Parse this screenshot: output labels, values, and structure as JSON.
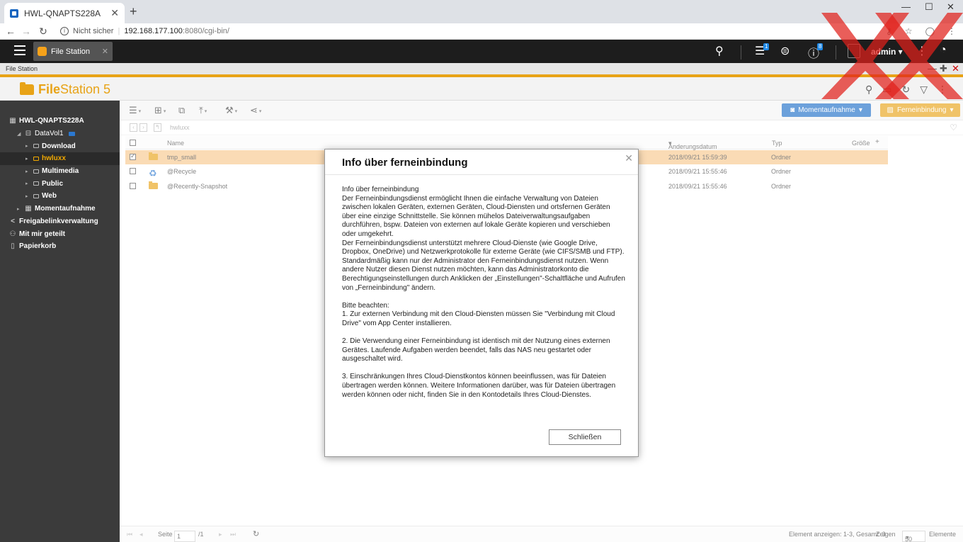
{
  "browser": {
    "tab_title": "HWL-QNAPTS228A",
    "new_tab": "+",
    "security": "Nicht sicher",
    "url_host": "192.168.177.100",
    "url_path": ":8080/cgi-bin/"
  },
  "qts": {
    "app_tab": "File Station",
    "badge_tasks": "1",
    "badge_info": "8",
    "user": "admin"
  },
  "window": {
    "title": "File Station",
    "brand_prefix": "File",
    "brand_suffix": "Station 5"
  },
  "sidebar": {
    "items": [
      {
        "label": "HWL-QNAPTS228A"
      },
      {
        "label": "DataVol1"
      },
      {
        "label": "Download"
      },
      {
        "label": "hwluxx"
      },
      {
        "label": "Multimedia"
      },
      {
        "label": "Public"
      },
      {
        "label": "Web"
      },
      {
        "label": "Momentaufnahme"
      },
      {
        "label": "Freigabelinkverwaltung"
      },
      {
        "label": "Mit mir geteilt"
      },
      {
        "label": "Papierkorb"
      }
    ]
  },
  "toolbar": {
    "snapshot_label": "Momentaufnahme",
    "remote_label": "Ferneinbindung"
  },
  "path": "hwluxx",
  "table": {
    "headers": {
      "name": "Name",
      "date": "Änderungsdatum",
      "type": "Typ",
      "size": "Größe"
    },
    "rows": [
      {
        "name": "tmp_small",
        "date": "2018/09/21 15:59:39",
        "type": "Ordner"
      },
      {
        "name": "@Recycle",
        "date": "2018/09/21 15:55:46",
        "type": "Ordner"
      },
      {
        "name": "@Recently-Snapshot",
        "date": "2018/09/21 15:55:46",
        "type": "Ordner"
      }
    ]
  },
  "footer": {
    "page_label": "Seite",
    "page_value": "1",
    "page_total": "/1",
    "summary": "Element anzeigen: 1-3, Gesamt: 3",
    "show_label": "Zeigen",
    "per_page": "50",
    "items_label": "Elemente"
  },
  "dialog": {
    "title": "Info über ferneinbindung",
    "p1": "Info über ferneinbindung",
    "p2": "Der Ferneinbindungsdienst ermöglicht Ihnen die einfache Verwaltung von Dateien zwischen lokalen Geräten, externen Geräten, Cloud-Diensten und ortsfernen Geräten über eine einzige Schnittstelle. Sie können mühelos Dateiverwaltungsaufgaben durchführen, bspw. Dateien von externen auf lokale Geräte kopieren und verschieben oder umgekehrt.",
    "p3": "Der Ferneinbindungsdienst unterstützt mehrere Cloud-Dienste (wie Google Drive, Dropbox, OneDrive) und Netzwerkprotokolle für externe Geräte (wie CIFS/SMB und FTP).",
    "p4": "Standardmäßig kann nur der Administrator den Ferneinbindungsdienst nutzen. Wenn andere Nutzer diesen Dienst nutzen möchten, kann das Administratorkonto die Berechtigungseinstellungen durch Anklicken der „Einstellungen\"-Schaltfläche und Aufrufen von „Ferneinbindung\" ändern.",
    "note": "Bitte beachten:",
    "n1": "1. Zur externen Verbindung mit den Cloud-Diensten müssen Sie \"Verbindung mit Cloud Drive\" vom App Center installieren.",
    "n2": "2. Die Verwendung einer Ferneinbindung ist identisch mit der Nutzung eines externen Gerätes. Laufende Aufgaben werden beendet, falls das NAS neu gestartet oder ausgeschaltet wird.",
    "n3": "3. Einschränkungen Ihres Cloud-Dienstkontos können beeinflussen, was für Dateien übertragen werden können. Weitere Informationen darüber, was für Dateien übertragen werden können oder nicht, finden Sie in den Kontodetails Ihres Cloud-Dienstes.",
    "close_label": "Schließen"
  },
  "colors": {
    "accent": "#e8a317",
    "primary": "#1e6fc8",
    "selection": "#f8c88e",
    "sidebar_bg": "#3b3b3b"
  }
}
